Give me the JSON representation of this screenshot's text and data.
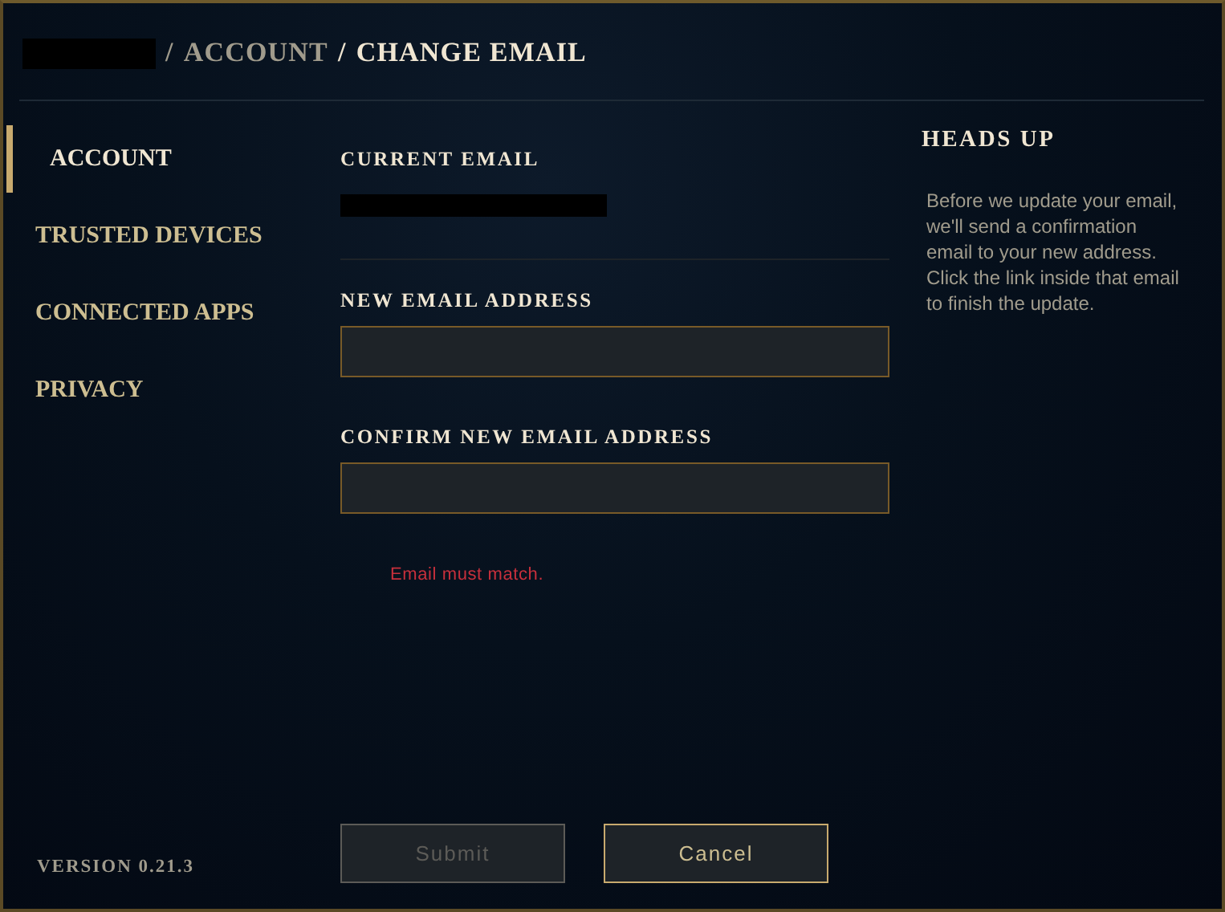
{
  "breadcrumb": [
    {
      "separator": "/",
      "label": "ACCOUNT",
      "current": false
    },
    {
      "separator": "/",
      "label": "CHANGE EMAIL",
      "current": true
    }
  ],
  "sidebar": {
    "items": [
      {
        "label": "ACCOUNT",
        "selected": true
      },
      {
        "label": "TRUSTED DEVICES",
        "selected": false
      },
      {
        "label": "CONNECTED APPS",
        "selected": false
      },
      {
        "label": "PRIVACY",
        "selected": false
      }
    ],
    "version": "VERSION 0.21.3"
  },
  "form": {
    "current_email": {
      "label": "CURRENT EMAIL"
    },
    "fields": [
      {
        "label": "NEW EMAIL ADDRESS"
      },
      {
        "label": "CONFIRM NEW EMAIL ADDRESS"
      }
    ],
    "error": "Email must match.",
    "buttons": [
      {
        "label": "Submit",
        "disabled": true
      },
      {
        "label": "Cancel",
        "disabled": false
      }
    ]
  },
  "heads_up": {
    "title": "HEADS UP",
    "body": "Before we update your email, we'll send a confirmation email to your new address. Click the link inside that email to finish the update."
  }
}
